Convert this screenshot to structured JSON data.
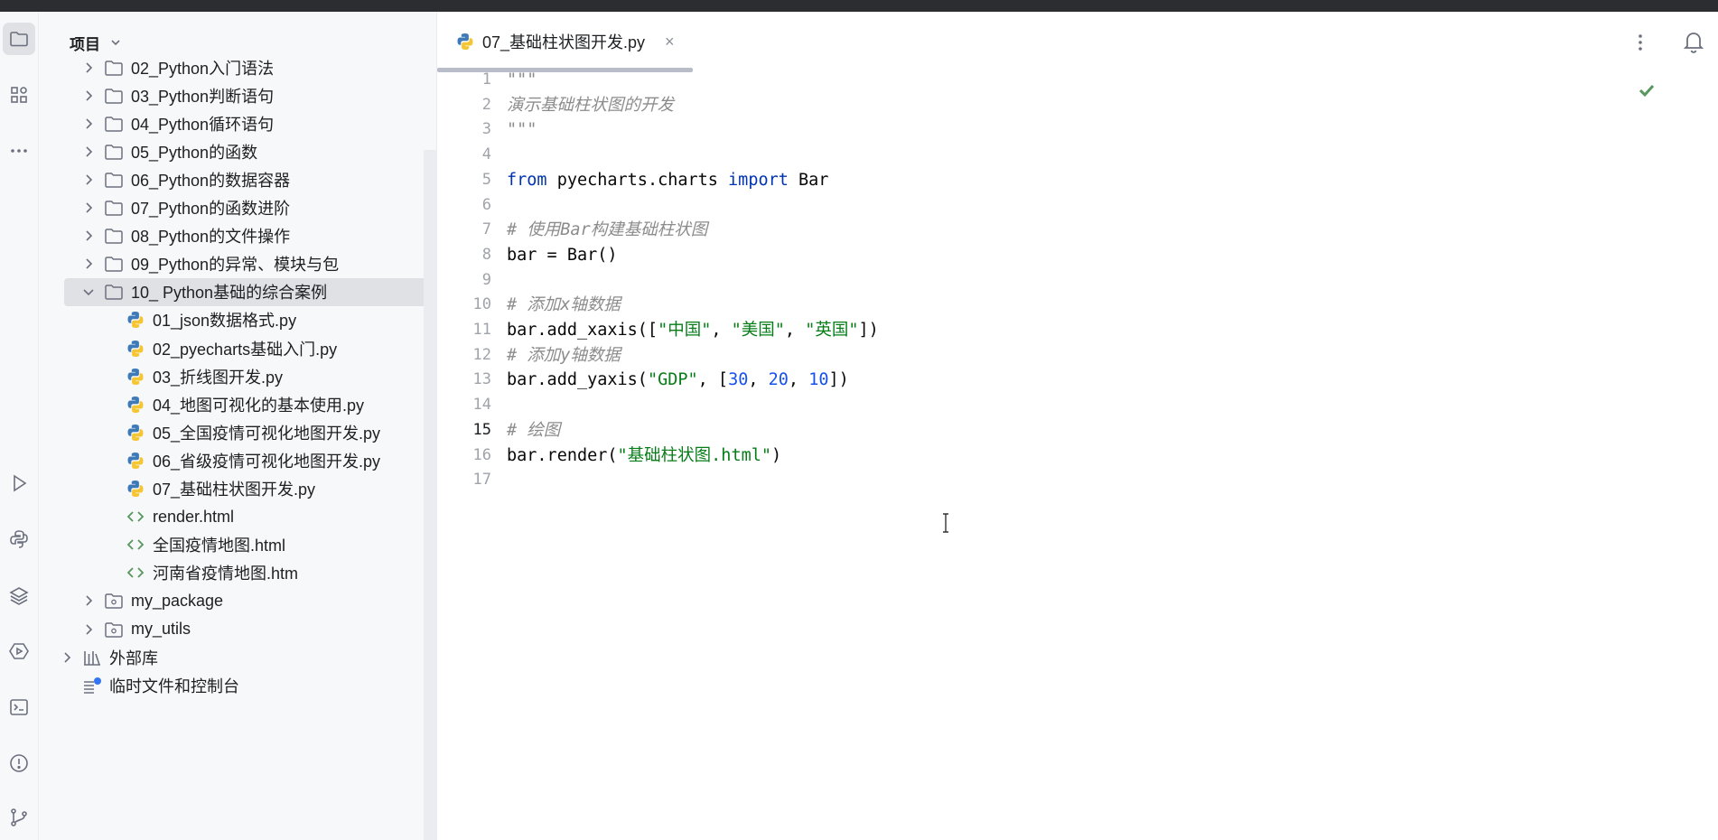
{
  "panel": {
    "title": "项目",
    "tree": [
      {
        "label": "02_Python入门语法",
        "type": "folder",
        "expanded": false
      },
      {
        "label": "03_Python判断语句",
        "type": "folder",
        "expanded": false
      },
      {
        "label": "04_Python循环语句",
        "type": "folder",
        "expanded": false
      },
      {
        "label": "05_Python的函数",
        "type": "folder",
        "expanded": false
      },
      {
        "label": "06_Python的数据容器",
        "type": "folder",
        "expanded": false
      },
      {
        "label": "07_Python的函数进阶",
        "type": "folder",
        "expanded": false
      },
      {
        "label": "08_Python的文件操作",
        "type": "folder",
        "expanded": false
      },
      {
        "label": "09_Python的异常、模块与包",
        "type": "folder",
        "expanded": false
      },
      {
        "label": "10_ Python基础的综合案例",
        "type": "folder",
        "expanded": true,
        "selected": true
      },
      {
        "label": "01_json数据格式.py",
        "type": "python-file"
      },
      {
        "label": "02_pyecharts基础入门.py",
        "type": "python-file"
      },
      {
        "label": "03_折线图开发.py",
        "type": "python-file"
      },
      {
        "label": "04_地图可视化的基本使用.py",
        "type": "python-file"
      },
      {
        "label": "05_全国疫情可视化地图开发.py",
        "type": "python-file"
      },
      {
        "label": "06_省级疫情可视化地图开发.py",
        "type": "python-file"
      },
      {
        "label": "07_基础柱状图开发.py",
        "type": "python-file"
      },
      {
        "label": "render.html",
        "type": "html-file"
      },
      {
        "label": "全国疫情地图.html",
        "type": "html-file"
      },
      {
        "label": "河南省疫情地图.htm",
        "type": "html-file"
      },
      {
        "label": "my_package",
        "type": "package",
        "expanded": false
      },
      {
        "label": "my_utils",
        "type": "package",
        "expanded": false
      },
      {
        "label": "外部库",
        "type": "library",
        "expanded": false
      },
      {
        "label": "临时文件和控制台",
        "type": "scratches"
      }
    ]
  },
  "editor": {
    "tab_label": "07_基础柱状图开发.py",
    "current_line": 15,
    "lines": [
      [
        {
          "t": "\"\"\"",
          "c": "cm"
        }
      ],
      [
        {
          "t": "演示基础柱状图的开发",
          "c": "cm"
        }
      ],
      [
        {
          "t": "\"\"\"",
          "c": "cm"
        }
      ],
      [],
      [
        {
          "t": "from",
          "c": "kw"
        },
        {
          "t": " pyecharts.charts ",
          "c": ""
        },
        {
          "t": "import",
          "c": "kw"
        },
        {
          "t": " Bar",
          "c": ""
        }
      ],
      [],
      [
        {
          "t": "# 使用Bar构建基础柱状图",
          "c": "cm"
        }
      ],
      [
        {
          "t": "bar = Bar()",
          "c": ""
        }
      ],
      [],
      [
        {
          "t": "# 添加x轴数据",
          "c": "cm"
        }
      ],
      [
        {
          "t": "bar.add_xaxis([",
          "c": ""
        },
        {
          "t": "\"中国\"",
          "c": "str"
        },
        {
          "t": ", ",
          "c": ""
        },
        {
          "t": "\"美国\"",
          "c": "str"
        },
        {
          "t": ", ",
          "c": ""
        },
        {
          "t": "\"英国\"",
          "c": "str"
        },
        {
          "t": "])",
          "c": ""
        }
      ],
      [
        {
          "t": "# 添加y轴数据",
          "c": "cm"
        }
      ],
      [
        {
          "t": "bar.add_yaxis(",
          "c": ""
        },
        {
          "t": "\"GDP\"",
          "c": "str"
        },
        {
          "t": ", [",
          "c": ""
        },
        {
          "t": "30",
          "c": "num"
        },
        {
          "t": ", ",
          "c": ""
        },
        {
          "t": "20",
          "c": "num"
        },
        {
          "t": ", ",
          "c": ""
        },
        {
          "t": "10",
          "c": "num"
        },
        {
          "t": "])",
          "c": ""
        }
      ],
      [],
      [
        {
          "t": "# 绘图",
          "c": "cm"
        }
      ],
      [
        {
          "t": "bar.render(",
          "c": ""
        },
        {
          "t": "\"基础柱状图.html\"",
          "c": "str"
        },
        {
          "t": ")",
          "c": ""
        }
      ],
      []
    ]
  },
  "colors": {
    "keyword": "#0033b3",
    "string": "#067d17",
    "number": "#1750eb",
    "comment": "#8c8c8c",
    "success": "#57965c"
  },
  "icons": {
    "toolstrip": [
      "folder-icon",
      "structure-icon",
      "more-tools-icon",
      "run-icon",
      "python-console-icon",
      "layers-icon",
      "services-icon",
      "terminal-icon",
      "problems-icon",
      "git-icon"
    ]
  }
}
